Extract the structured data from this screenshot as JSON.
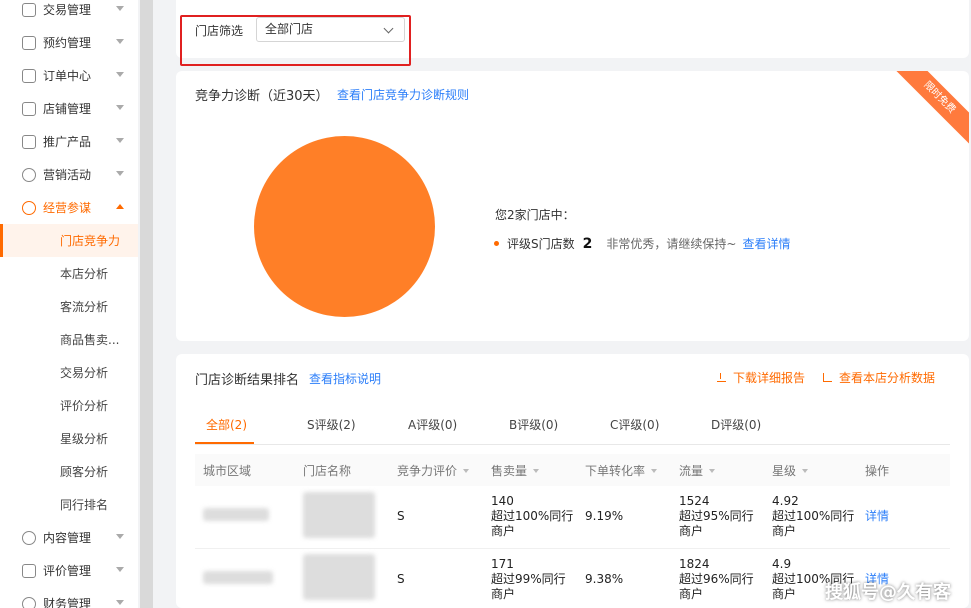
{
  "sidebar": {
    "items": [
      {
        "label": "交易管理",
        "icon": "calendar-icon"
      },
      {
        "label": "预约管理",
        "icon": "check-square-icon"
      },
      {
        "label": "订单中心",
        "icon": "clipboard-icon"
      },
      {
        "label": "店铺管理",
        "icon": "store-icon"
      },
      {
        "label": "推广产品",
        "icon": "megaphone-icon"
      },
      {
        "label": "营销活动",
        "icon": "user-icon"
      },
      {
        "label": "经营参谋",
        "icon": "dashboard-icon"
      }
    ],
    "subitems": [
      "门店竞争力",
      "本店分析",
      "客流分析",
      "商品售卖...",
      "交易分析",
      "评价分析",
      "星级分析",
      "顾客分析",
      "同行排名"
    ],
    "items_after": [
      {
        "label": "内容管理",
        "icon": "content-icon"
      },
      {
        "label": "评价管理",
        "icon": "thumbs-up-icon"
      },
      {
        "label": "财务管理",
        "icon": "wallet-icon"
      }
    ]
  },
  "filter": {
    "label": "门店筛选",
    "value": "全部门店"
  },
  "diagnosis": {
    "title": "竞争力诊断（近30天）",
    "rule_link": "查看门店竞争力诊断规则",
    "ribbon": "限时免费",
    "summary": "您2家门店中：",
    "grade_label": "评级S门店数",
    "grade_count": "2",
    "grade_note": "非常优秀，请继续保持~",
    "detail_link": "查看详情"
  },
  "chart_data": {
    "type": "pie",
    "categories": [
      "评级S"
    ],
    "values": [
      2
    ],
    "colors": [
      "#ff7f27"
    ]
  },
  "ranking": {
    "title": "门店诊断结果排名",
    "indicator_link": "查看指标说明",
    "download": "下载详细报告",
    "view_data": "查看本店分析数据",
    "tabs": [
      "全部(2)",
      "S评级(2)",
      "A评级(0)",
      "B评级(0)",
      "C评级(0)",
      "D评级(0)"
    ],
    "columns": [
      "城市区域",
      "门店名称",
      "竞争力评价",
      "售卖量",
      "下单转化率",
      "流量",
      "星级",
      "操作"
    ],
    "rows": [
      {
        "grade": "S",
        "sales": "140",
        "sales_note": "超过100%同行商户",
        "conversion": "9.19%",
        "traffic": "1524",
        "traffic_note": "超过95%同行商户",
        "star": "4.92",
        "star_note": "超过100%同行商户",
        "action": "详情"
      },
      {
        "grade": "S",
        "sales": "171",
        "sales_note": "超过99%同行商户",
        "conversion": "9.38%",
        "traffic": "1824",
        "traffic_note": "超过96%同行商户",
        "star": "4.9",
        "star_note": "超过100%同行商户",
        "action": "详情"
      }
    ]
  },
  "watermark": "搜狐号@久有客",
  "colors": {
    "accent": "#ff6a00",
    "link": "#2d7ff9",
    "highlight_box": "#e02020"
  }
}
